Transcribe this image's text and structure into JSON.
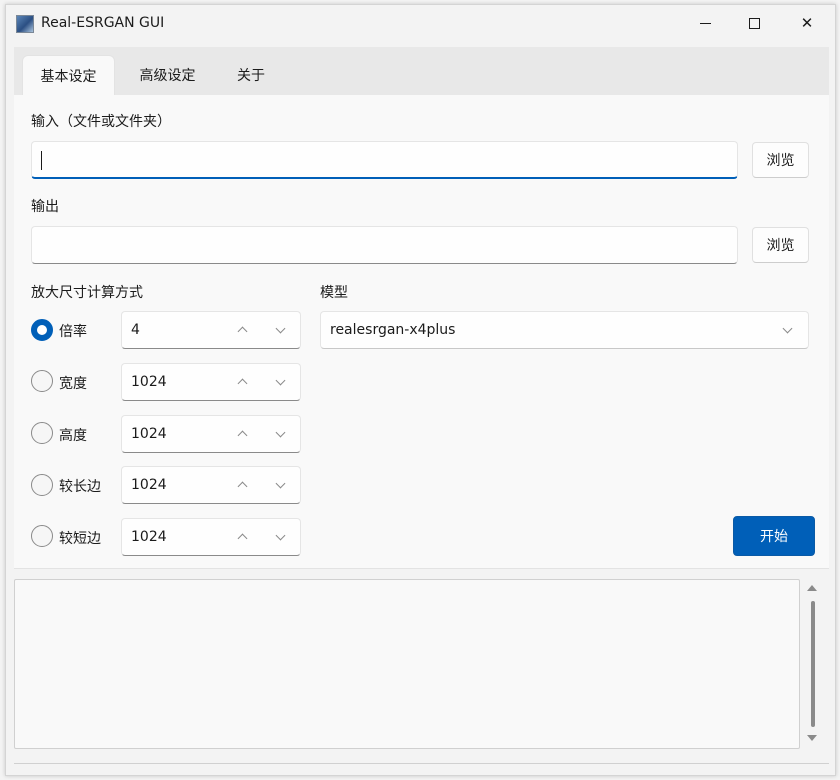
{
  "window": {
    "title": "Real-ESRGAN GUI",
    "minimize_icon": "minimize-icon",
    "maximize_icon": "maximize-icon",
    "close_icon": "close-icon",
    "close_glyph": "✕"
  },
  "tabs": [
    {
      "label": "基本设定",
      "active": true
    },
    {
      "label": "高级设定",
      "active": false
    },
    {
      "label": "关于",
      "active": false
    }
  ],
  "input": {
    "label": "输入（文件或文件夹）",
    "value": "",
    "browse_label": "浏览"
  },
  "output": {
    "label": "输出",
    "value": "",
    "browse_label": "浏览"
  },
  "scale_mode": {
    "label": "放大尺寸计算方式",
    "options": [
      {
        "label": "倍率",
        "value": "4",
        "checked": true
      },
      {
        "label": "宽度",
        "value": "1024",
        "checked": false
      },
      {
        "label": "高度",
        "value": "1024",
        "checked": false
      },
      {
        "label": "较长边",
        "value": "1024",
        "checked": false
      },
      {
        "label": "较短边",
        "value": "1024",
        "checked": false
      }
    ]
  },
  "model": {
    "label": "模型",
    "selected": "realesrgan-x4plus"
  },
  "start_label": "开始",
  "log": {
    "text": ""
  },
  "colors": {
    "accent": "#005fb8",
    "panel": "#f9f9f9",
    "background": "#f3f3f3"
  }
}
